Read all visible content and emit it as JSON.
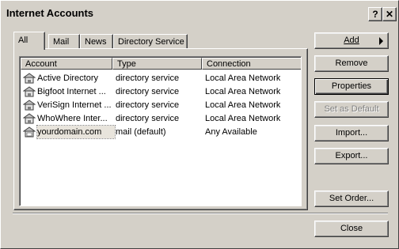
{
  "window": {
    "title": "Internet Accounts",
    "help_label": "?",
    "close_label": "✕"
  },
  "tabs": [
    {
      "label": "All",
      "active": true
    },
    {
      "label": "Mail",
      "active": false
    },
    {
      "label": "News",
      "active": false
    },
    {
      "label": "Directory Service",
      "active": false
    }
  ],
  "columns": {
    "account": "Account",
    "type": "Type",
    "connection": "Connection"
  },
  "accounts": [
    {
      "name": "Active Directory",
      "type": "directory service",
      "connection": "Local Area Network",
      "icon": "directory-service-icon"
    },
    {
      "name": "Bigfoot Internet ...",
      "type": "directory service",
      "connection": "Local Area Network",
      "icon": "directory-service-icon"
    },
    {
      "name": "VeriSign Internet ...",
      "type": "directory service",
      "connection": "Local Area Network",
      "icon": "directory-service-icon"
    },
    {
      "name": "WhoWhere Inter...",
      "type": "directory service",
      "connection": "Local Area Network",
      "icon": "directory-service-icon"
    },
    {
      "name": "yourdomain.com",
      "type": "mail (default)",
      "connection": "Any Available",
      "icon": "mail-account-icon",
      "selected": true
    }
  ],
  "buttons": {
    "add": "Add",
    "remove": "Remove",
    "properties": "Properties",
    "set_default": "Set as Default",
    "import": "Import...",
    "export": "Export...",
    "set_order": "Set Order...",
    "close": "Close"
  },
  "colors": {
    "face": "#d4d0c8",
    "shadow": "#808080",
    "highlight": "#ffffff",
    "dark": "#404040"
  }
}
